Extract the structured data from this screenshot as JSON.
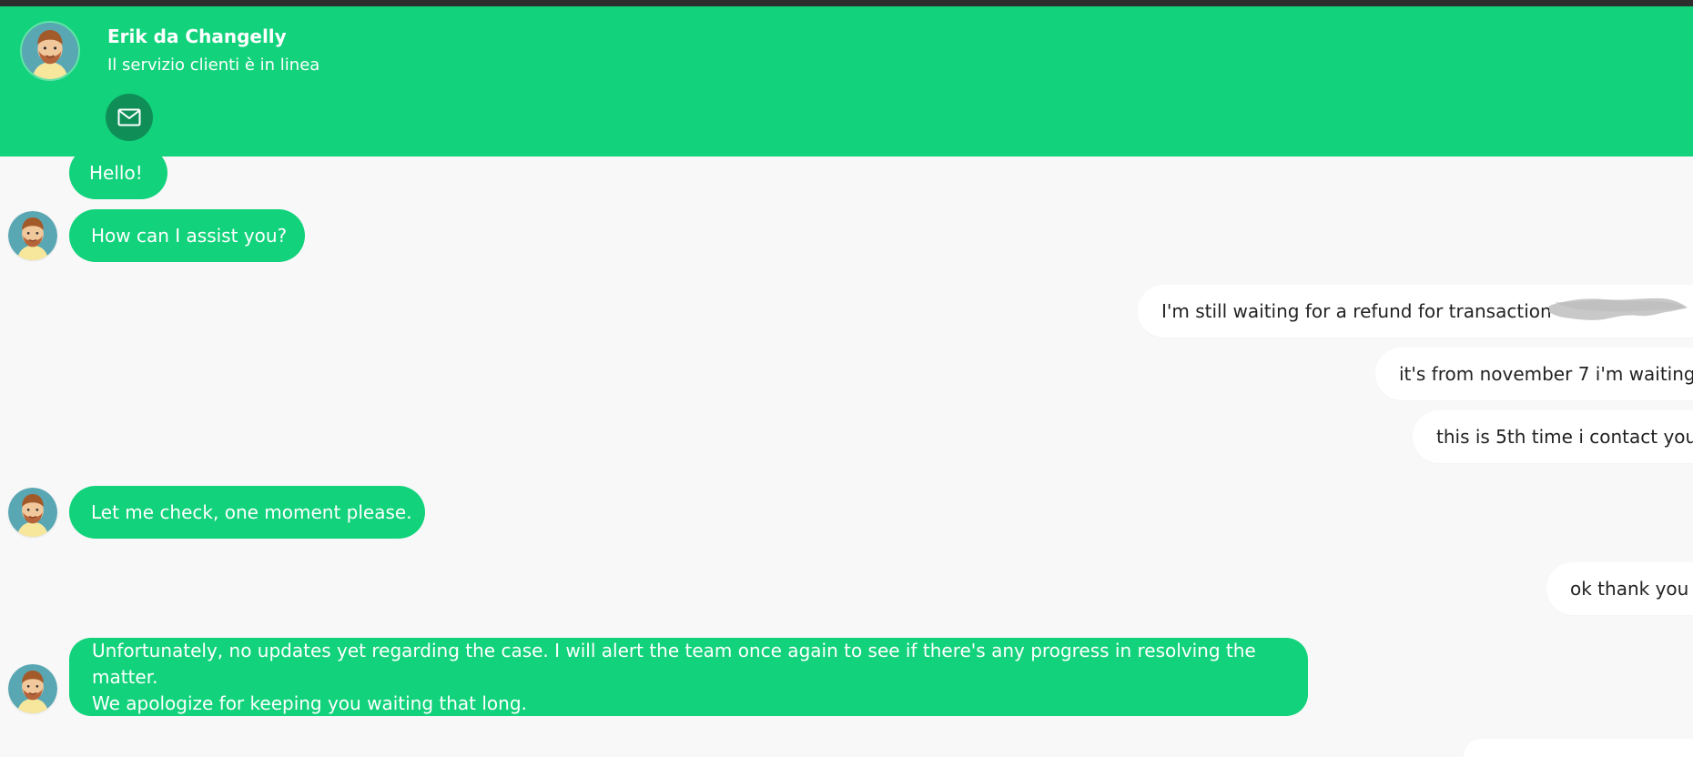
{
  "header": {
    "agent_name": "Erik da Changelly",
    "status": "Il servizio clienti è in linea",
    "email_icon": "envelope-icon",
    "avatar_icon": "agent-avatar-icon"
  },
  "messages": [
    {
      "sender": "agent",
      "text": "Hello!"
    },
    {
      "sender": "agent",
      "text": "How can I assist you?"
    },
    {
      "sender": "user",
      "text": "I'm still waiting for a refund for transaction"
    },
    {
      "sender": "user",
      "text": "it's from november 7 i'm waiting"
    },
    {
      "sender": "user",
      "text": "this is 5th time i contact you"
    },
    {
      "sender": "agent",
      "text": "Let me check, one moment please."
    },
    {
      "sender": "user",
      "text": "ok thank you"
    },
    {
      "sender": "agent",
      "lines": [
        "Unfortunately, no updates yet regarding the case. I will alert the team once again to see if there's any progress in resolving the matter.",
        "We apologize for keeping you waiting that long."
      ]
    }
  ],
  "colors": {
    "accent": "#12d27b",
    "accent_dark": "#0f8f57",
    "background": "#f8f8f8",
    "user_bubble": "#ffffff",
    "top_strip": "#2d2d2d",
    "redaction": "#c8c8c8"
  }
}
